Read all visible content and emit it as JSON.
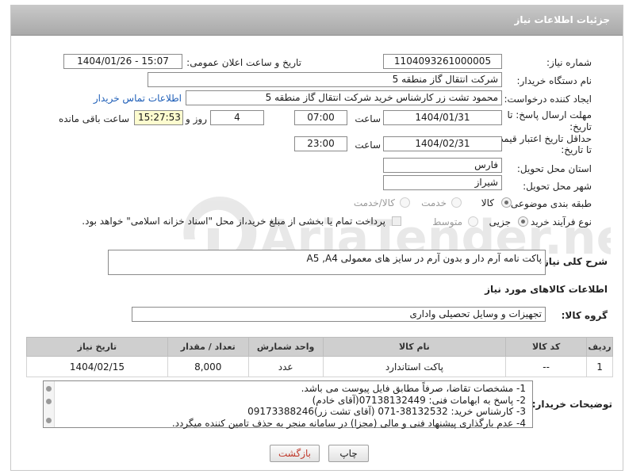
{
  "header": {
    "title": "جزئیات اطلاعات نیاز"
  },
  "fields": {
    "need_number_label": "شماره نیاز:",
    "need_number": "1104093261000005",
    "announce_label": "تاریخ و ساعت اعلان عمومی:",
    "announce_value": "1404/01/26 - 15:07",
    "buyer_org_label": "نام دستگاه خریدار:",
    "buyer_org": "شرکت انتقال گاز منطقه 5",
    "requester_label": "ایجاد کننده درخواست:",
    "requester": "محمود تشت زر کارشناس خرید شرکت انتقال گاز منطقه 5",
    "contact_link": "اطلاعات تماس خریدار",
    "deadline_label_1": "مهلت ارسال پاسخ: تا",
    "deadline_label_2": "تاریخ:",
    "deadline_date": "1404/01/31",
    "time_label": "ساعت",
    "deadline_time": "07:00",
    "days_value": "4",
    "days_label": "روز و",
    "remaining_time": "15:27:53",
    "remaining_label": "ساعت باقی مانده",
    "price_validity_label_1": "حداقل تاریخ اعتبار قیمت:",
    "price_validity_label_2": "تا تاریخ:",
    "price_validity_date": "1404/02/31",
    "price_validity_time": "23:00",
    "province_label": "استان محل تحویل:",
    "province": "فارس",
    "city_label": "شهر محل تحویل:",
    "city": "شیراز",
    "category_label": "طبقه بندی موضوعی:",
    "category_options": [
      "کالا",
      "خدمت",
      "کالا/خدمت"
    ],
    "process_label": "نوع فرآیند خرید :",
    "process_options": [
      "جزیی",
      "متوسط"
    ],
    "payment_note": "پرداخت تمام یا بخشی از مبلغ خرید،از محل \"اسناد خزانه اسلامی\" خواهد بود.",
    "description_label": "شرح کلی نیاز:",
    "description": "پاکت نامه آرم دار و بدون آرم در سایز های معمولی A5 ,A4"
  },
  "goods_section": {
    "title": "اطلاعات کالاهای مورد نیاز",
    "group_label": "گروه کالا:",
    "group_value": "تجهیزات و وسایل تحصیلی واداری",
    "columns": [
      "ردیف",
      "کد کالا",
      "نام کالا",
      "واحد شمارش",
      "تعداد / مقدار",
      "تاریخ نیاز"
    ],
    "rows": [
      [
        "1",
        "--",
        "پاکت استاندارد",
        "عدد",
        "8,000",
        "1404/02/15"
      ]
    ]
  },
  "buyer_notes": {
    "label": "توضیحات خریدار:",
    "lines": [
      "1-  مشخصات تقاضا، صرفاً مطابق فایل پیوست می باشد.",
      "2- پاسخ به ابهامات فنی: 07138132449(آقای خادم)",
      "3- کارشناس خرید: 38132532-071 (آقای تشت زر)09173388246",
      "4- عدم بارگذاری پیشنهاد فنی و مالی (مجزا) در سامانه منجر به حذف تامین کننده میگردد."
    ]
  },
  "buttons": {
    "print": "چاپ",
    "back": "بازگشت"
  },
  "watermark": {
    "text": "AriaTender.neT"
  },
  "colors": {
    "header_bg": "#b4b4b4",
    "link": "#1f5fb8",
    "remaining_bg": "#fdfccf",
    "back_text": "#c0392b"
  }
}
